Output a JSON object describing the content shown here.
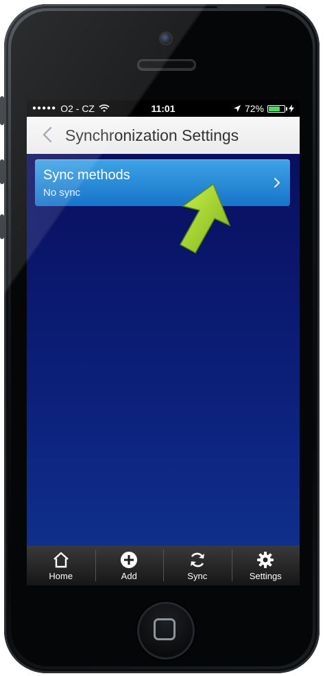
{
  "status_bar": {
    "signal": "●●●●●",
    "carrier": "O2 - CZ",
    "time": "11:01",
    "battery_percent": "72%",
    "battery_level": 0.72,
    "icons": [
      "wifi-icon",
      "location-arrow-icon",
      "battery-icon",
      "charging-bolt-icon"
    ]
  },
  "nav": {
    "title": "Synchronization Settings",
    "back_icon": "chevron-left-icon"
  },
  "sync_row": {
    "title": "Sync methods",
    "subtitle": "No sync",
    "icon": "chevron-right-icon"
  },
  "annotation": {
    "icon": "green-pointer-arrow-icon",
    "color": "#9acd32"
  },
  "tabs": [
    {
      "label": "Home",
      "icon": "home-icon"
    },
    {
      "label": "Add",
      "icon": "add-circle-icon"
    },
    {
      "label": "Sync",
      "icon": "sync-icon"
    },
    {
      "label": "Settings",
      "icon": "gear-icon"
    }
  ],
  "colors": {
    "content_top": "#0a0f5e",
    "content_bottom": "#0f2f8b",
    "row_accent": "#1f86d8",
    "battery": "#4cd964"
  }
}
